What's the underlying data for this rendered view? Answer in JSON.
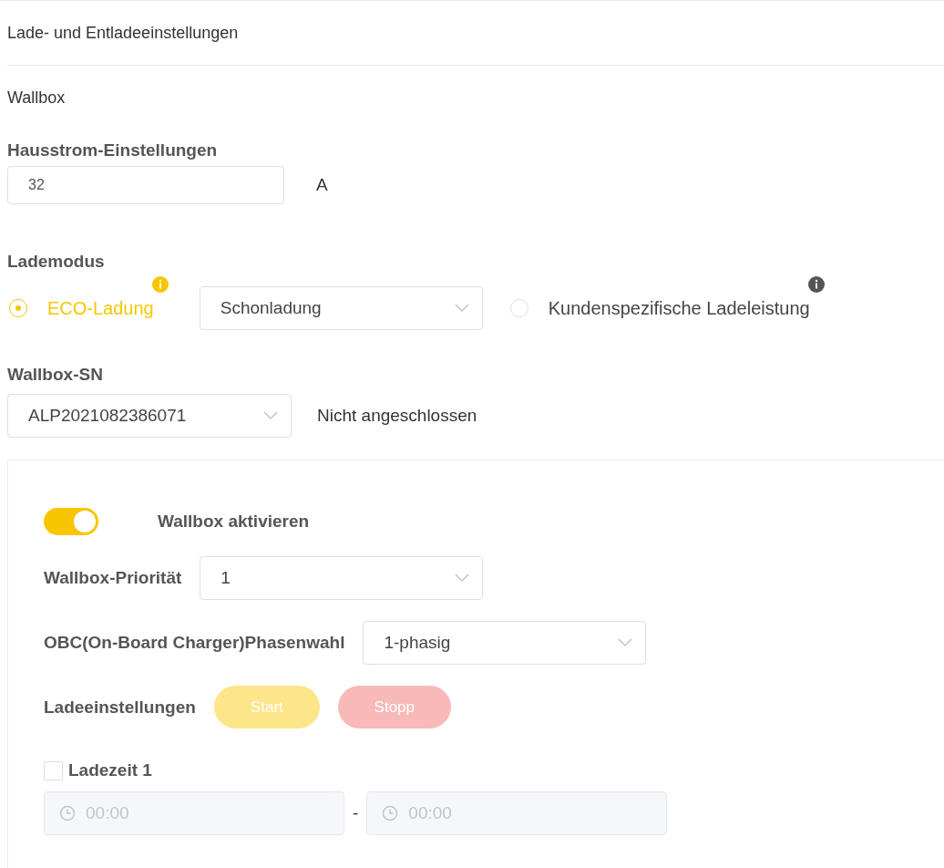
{
  "header": {
    "title": "Lade- und Entladeeinstellungen"
  },
  "section_title": "Wallbox",
  "house_current": {
    "label": "Hausstrom-Einstellungen",
    "value": "32",
    "unit": "A"
  },
  "charge_mode": {
    "label": "Lademodus",
    "options": [
      {
        "kind": "eco",
        "label": "ECO-Ladung",
        "selected": true,
        "select_value": "Schonladung"
      },
      {
        "kind": "custom",
        "label": "Kundenspezifische Ladeleistung",
        "selected": false
      }
    ]
  },
  "wallbox_sn": {
    "label": "Wallbox-SN",
    "value": "ALP2021082386071",
    "status": "Nicht angeschlossen"
  },
  "wallbox_card": {
    "enable": {
      "label": "Wallbox aktivieren",
      "on": true
    },
    "priority": {
      "label": "Wallbox-Priorität",
      "value": "1"
    },
    "phase": {
      "label": "OBC(On-Board Charger)Phasenwahl",
      "value": "1-phasig"
    },
    "charge_settings": {
      "label": "Ladeeinstellungen",
      "buttons": [
        {
          "kind": "start",
          "label": "Start",
          "disabled": true
        },
        {
          "kind": "stop",
          "label": "Stopp",
          "disabled": true
        }
      ]
    },
    "charge_times": [
      {
        "label": "Ladezeit 1",
        "checked": false,
        "start_placeholder": "00:00",
        "separator": "-",
        "end_placeholder": "00:00"
      }
    ]
  }
}
